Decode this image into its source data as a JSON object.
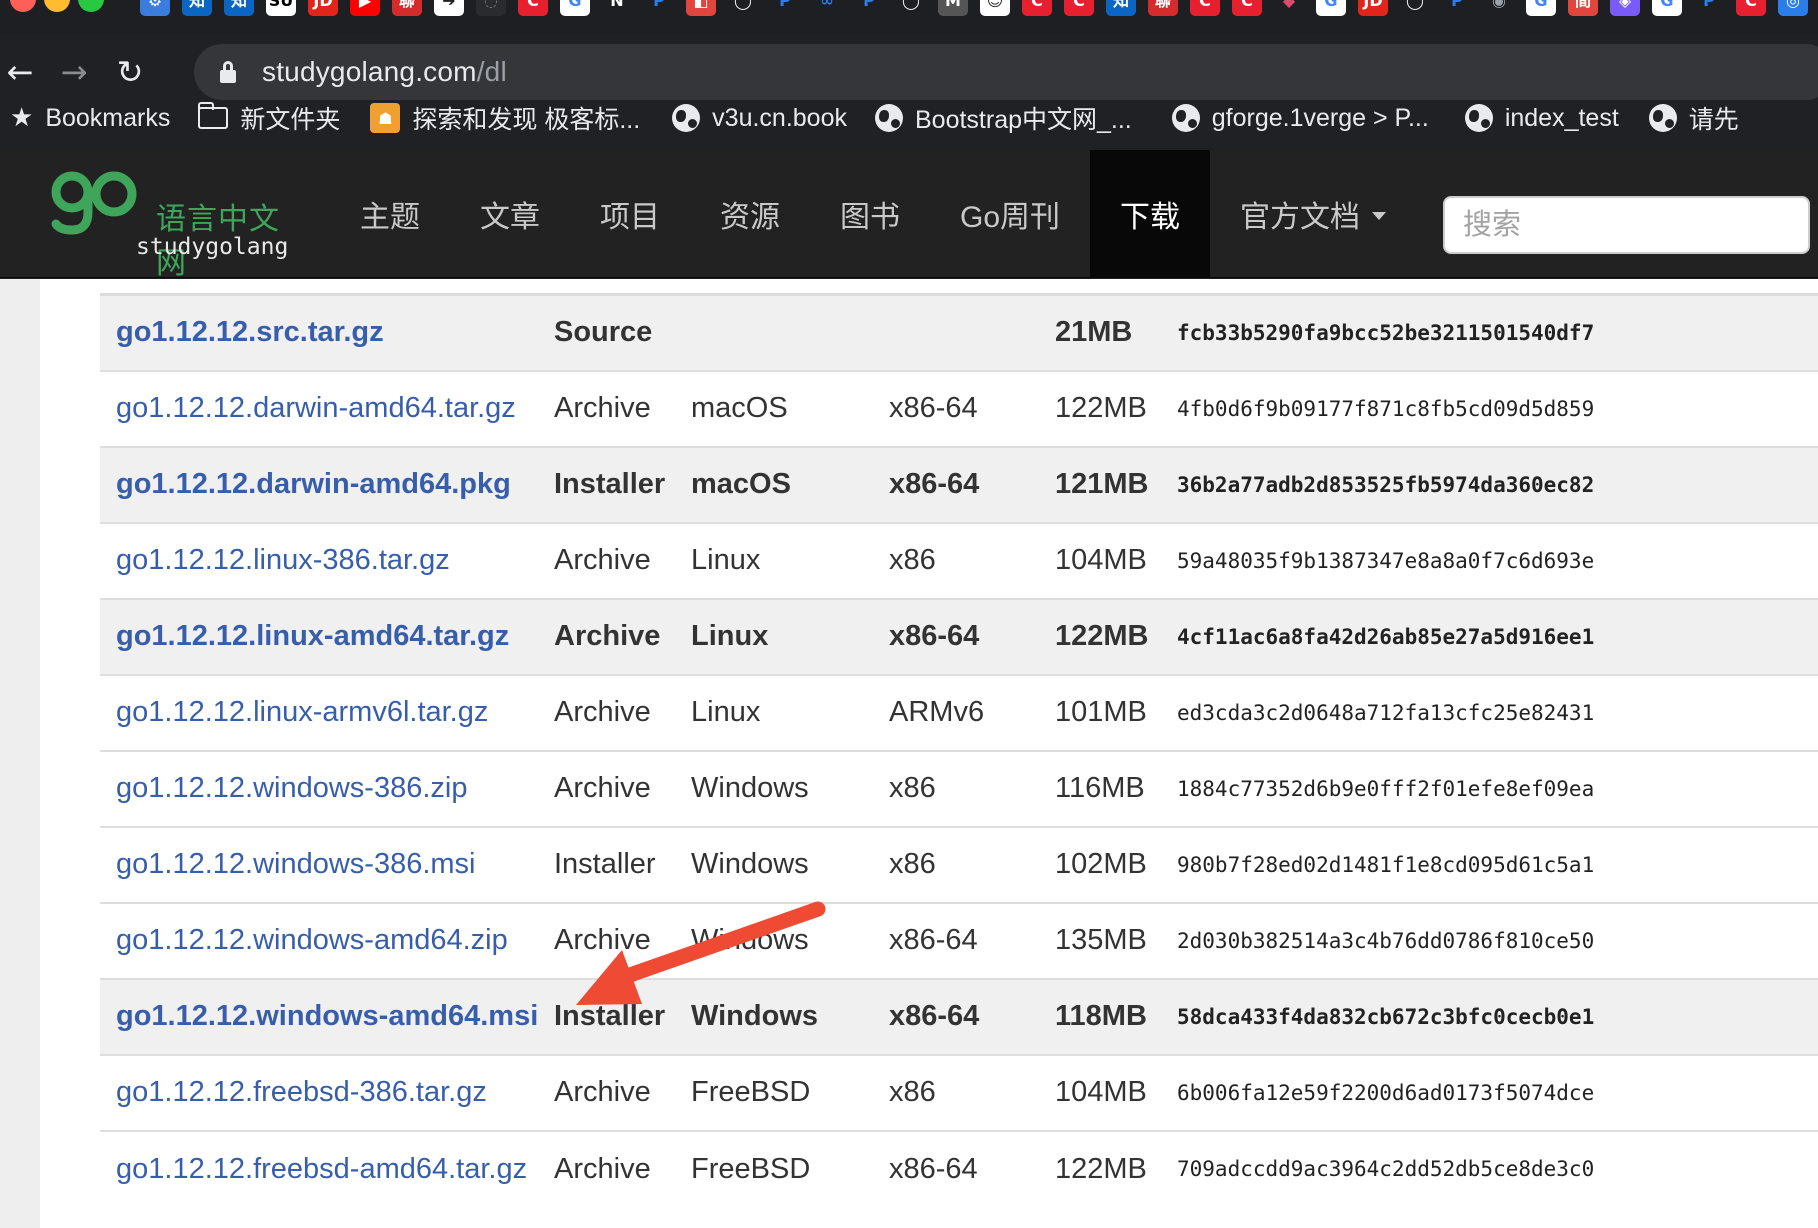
{
  "tabstrip": {
    "favicons": [
      {
        "glyph": "⚙",
        "bg": "#3b7ddd"
      },
      {
        "glyph": "知",
        "bg": "#0a66c2"
      },
      {
        "glyph": "知",
        "bg": "#0a66c2"
      },
      {
        "glyph": "SU",
        "bg": "#ffffff",
        "fg": "#000000"
      },
      {
        "glyph": "JD",
        "bg": "#e1251b"
      },
      {
        "glyph": "▶",
        "bg": "#ff0000"
      },
      {
        "glyph": "聯",
        "bg": "#d42c2c"
      },
      {
        "glyph": "➔",
        "bg": "#ffffff",
        "fg": "#222222"
      },
      {
        "glyph": "◌",
        "bg": "#2a2b2e",
        "fg": "#777777"
      },
      {
        "glyph": "C",
        "bg": "#e6202e"
      },
      {
        "glyph": "G",
        "bg": "#ffffff",
        "fg": "#4285f4"
      },
      {
        "glyph": "N",
        "bg": "#1e1f22"
      },
      {
        "glyph": "P",
        "bg": "#1e1f22",
        "fg": "#2b7de9"
      },
      {
        "glyph": "◧",
        "bg": "#e0463d"
      },
      {
        "glyph": "◯",
        "bg": "#1e1f22",
        "fg": "#e8eaed"
      },
      {
        "glyph": "P",
        "bg": "#1e1f22",
        "fg": "#2b7de9"
      },
      {
        "glyph": "∞",
        "bg": "#1e1f22",
        "fg": "#2b7de9"
      },
      {
        "glyph": "P",
        "bg": "#1e1f22",
        "fg": "#2b7de9"
      },
      {
        "glyph": "◯",
        "bg": "#1e1f22",
        "fg": "#e8eaed"
      },
      {
        "glyph": "M",
        "bg": "#555555"
      },
      {
        "glyph": "☺",
        "bg": "#ffffff",
        "fg": "#333333"
      },
      {
        "glyph": "C",
        "bg": "#e6202e"
      },
      {
        "glyph": "C",
        "bg": "#e6202e"
      },
      {
        "glyph": "知",
        "bg": "#0a66c2"
      },
      {
        "glyph": "聯",
        "bg": "#d42c2c"
      },
      {
        "glyph": "C",
        "bg": "#e6202e"
      },
      {
        "glyph": "C",
        "bg": "#e6202e"
      },
      {
        "glyph": "◆",
        "bg": "#1e1f22",
        "fg": "#d94b6a"
      },
      {
        "glyph": "G",
        "bg": "#ffffff",
        "fg": "#4285f4"
      },
      {
        "glyph": "JD",
        "bg": "#e1251b"
      },
      {
        "glyph": "◯",
        "bg": "#1e1f22",
        "fg": "#e8eaed"
      },
      {
        "glyph": "P",
        "bg": "#1e1f22",
        "fg": "#2b7de9"
      },
      {
        "glyph": "◉",
        "bg": "#1e1f22",
        "fg": "#9aa0a6"
      },
      {
        "glyph": "G",
        "bg": "#ffffff",
        "fg": "#4285f4"
      },
      {
        "glyph": "間",
        "bg": "#e0463d"
      },
      {
        "glyph": "◈",
        "bg": "#7a5af8"
      },
      {
        "glyph": "G",
        "bg": "#ffffff",
        "fg": "#4285f4"
      },
      {
        "glyph": "P",
        "bg": "#1e1f22",
        "fg": "#2b7de9"
      },
      {
        "glyph": "C",
        "bg": "#e6202e"
      },
      {
        "glyph": "◎",
        "bg": "#2b7de9"
      }
    ]
  },
  "browser": {
    "back_icon": "←",
    "forward_icon": "→",
    "reload_icon": "↻",
    "url_host": "studygolang.com",
    "url_path": "/dl",
    "bookmarks": [
      {
        "label": "Bookmarks",
        "icon": "star-icon"
      },
      {
        "label": "新文件夹",
        "icon": "folder-icon"
      },
      {
        "label": "探索和发现 极客标...",
        "icon": "site-icon"
      },
      {
        "label": "v3u.cn.book",
        "icon": "globe-icon"
      },
      {
        "label": "Bootstrap中文网_...",
        "icon": "globe-icon"
      },
      {
        "label": "gforge.1verge > P...",
        "icon": "globe-icon"
      },
      {
        "label": "index_test",
        "icon": "globe-icon"
      },
      {
        "label": "请先",
        "icon": "globe-icon"
      }
    ]
  },
  "site": {
    "logo_cn": "语言中文网",
    "logo_en": "studygolang",
    "nav": [
      "主题",
      "文章",
      "项目",
      "资源",
      "图书",
      "Go周刊",
      "下载",
      "官方文档"
    ],
    "active_nav": "下载",
    "search_placeholder": "搜索",
    "colors": {
      "logo_green": "#3fa55a",
      "link_blue": "#375eab",
      "navbar_bg": "#222222"
    }
  },
  "downloads": {
    "rows": [
      {
        "file": "go1.12.12.src.tar.gz",
        "kind": "Source",
        "os": "",
        "arch": "",
        "size": "21MB",
        "sha": "fcb33b5290fa9bcc52be3211501540df7",
        "highlight": true
      },
      {
        "file": "go1.12.12.darwin-amd64.tar.gz",
        "kind": "Archive",
        "os": "macOS",
        "arch": "x86-64",
        "size": "122MB",
        "sha": "4fb0d6f9b09177f871c8fb5cd09d5d859",
        "highlight": false
      },
      {
        "file": "go1.12.12.darwin-amd64.pkg",
        "kind": "Installer",
        "os": "macOS",
        "arch": "x86-64",
        "size": "121MB",
        "sha": "36b2a77adb2d853525fb5974da360ec82",
        "highlight": true
      },
      {
        "file": "go1.12.12.linux-386.tar.gz",
        "kind": "Archive",
        "os": "Linux",
        "arch": "x86",
        "size": "104MB",
        "sha": "59a48035f9b1387347e8a8a0f7c6d693e",
        "highlight": false
      },
      {
        "file": "go1.12.12.linux-amd64.tar.gz",
        "kind": "Archive",
        "os": "Linux",
        "arch": "x86-64",
        "size": "122MB",
        "sha": "4cf11ac6a8fa42d26ab85e27a5d916ee1",
        "highlight": true
      },
      {
        "file": "go1.12.12.linux-armv6l.tar.gz",
        "kind": "Archive",
        "os": "Linux",
        "arch": "ARMv6",
        "size": "101MB",
        "sha": "ed3cda3c2d0648a712fa13cfc25e82431",
        "highlight": false
      },
      {
        "file": "go1.12.12.windows-386.zip",
        "kind": "Archive",
        "os": "Windows",
        "arch": "x86",
        "size": "116MB",
        "sha": "1884c77352d6b9e0fff2f01efe8ef09ea",
        "highlight": false
      },
      {
        "file": "go1.12.12.windows-386.msi",
        "kind": "Installer",
        "os": "Windows",
        "arch": "x86",
        "size": "102MB",
        "sha": "980b7f28ed02d1481f1e8cd095d61c5a1",
        "highlight": false
      },
      {
        "file": "go1.12.12.windows-amd64.zip",
        "kind": "Archive",
        "os": "Windows",
        "arch": "x86-64",
        "size": "135MB",
        "sha": "2d030b382514a3c4b76dd0786f810ce50",
        "highlight": false
      },
      {
        "file": "go1.12.12.windows-amd64.msi",
        "kind": "Installer",
        "os": "Windows",
        "arch": "x86-64",
        "size": "118MB",
        "sha": "58dca433f4da832cb672c3bfc0cecb0e1",
        "highlight": true
      },
      {
        "file": "go1.12.12.freebsd-386.tar.gz",
        "kind": "Archive",
        "os": "FreeBSD",
        "arch": "x86",
        "size": "104MB",
        "sha": "6b006fa12e59f2200d6ad0173f5074dce",
        "highlight": false
      },
      {
        "file": "go1.12.12.freebsd-amd64.tar.gz",
        "kind": "Archive",
        "os": "FreeBSD",
        "arch": "x86-64",
        "size": "122MB",
        "sha": "709adccdd9ac3964c2dd52db5ce8de3c0",
        "highlight": false
      }
    ]
  },
  "annotation": {
    "color": "#ee4a34",
    "points_to": "go1.12.12.windows-amd64.msi"
  }
}
